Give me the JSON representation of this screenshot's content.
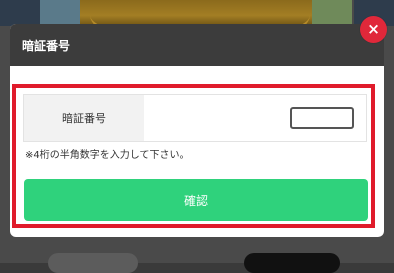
{
  "modal": {
    "title": "暗証番号",
    "close_icon": "×",
    "field_label": "暗証番号",
    "pin_value": "",
    "note": "※4桁の半角数字を入力して下さい。",
    "confirm_label": "確認"
  },
  "colors": {
    "header_bg": "#3c3c3c",
    "close_bg": "#e0283a",
    "highlight_border": "#e01b2b",
    "confirm_bg": "#2fd27c"
  }
}
